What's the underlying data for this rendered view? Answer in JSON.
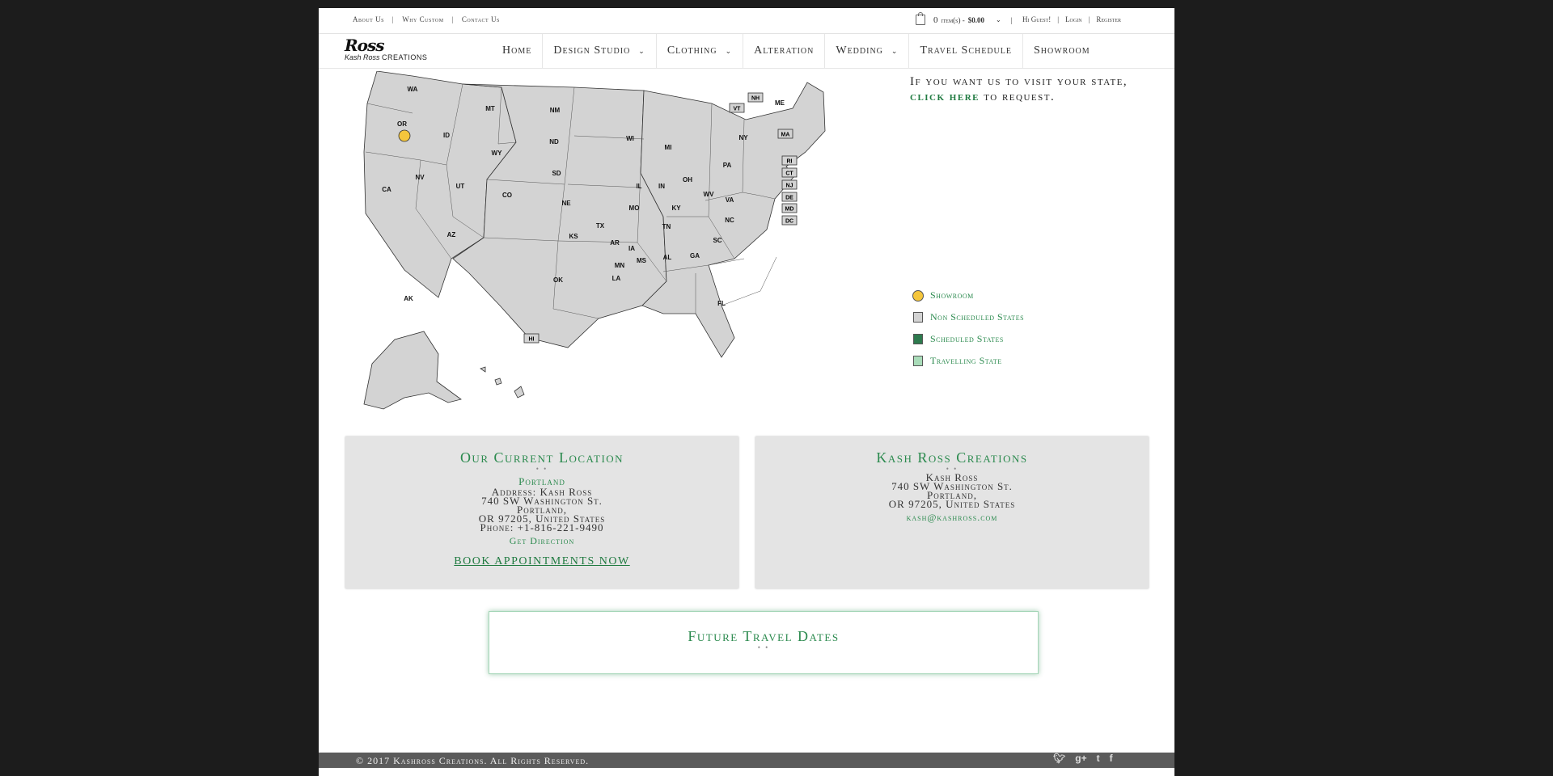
{
  "top_links": [
    "About Us",
    "Why Custom",
    "Contact Us"
  ],
  "cart": {
    "count": "0",
    "items_label": "item(s) -",
    "total": "$0.00"
  },
  "user_links": [
    "Hi Guest!",
    "Login",
    "Register"
  ],
  "logo": {
    "line1": "Ross",
    "line2a": "Kash Ross",
    "line2b": "CREATIONS"
  },
  "nav": [
    "Home",
    "Design Studio",
    "Clothing",
    "Alteration",
    "Wedding",
    "Travel Schedule",
    "Showroom"
  ],
  "visit": {
    "before": "If you want us to visit your state,",
    "link": "click here",
    "after": "to request."
  },
  "legend": [
    {
      "label": "Showroom",
      "color": "#f5c63c"
    },
    {
      "label": "Non Scheduled States",
      "color": "#d3d3d3"
    },
    {
      "label": "Scheduled States",
      "color": "#2e7a4e"
    },
    {
      "label": "Travelling State",
      "color": "#a9dcb9"
    }
  ],
  "map_states": [
    "WA",
    "OR",
    "CA",
    "ID",
    "NV",
    "MT",
    "WY",
    "UT",
    "AZ",
    "CO",
    "NM",
    "ND",
    "SD",
    "NE",
    "KS",
    "OK",
    "TX",
    "MN",
    "IA",
    "MO",
    "AR",
    "LA",
    "WI",
    "IL",
    "MI",
    "IN",
    "OH",
    "KY",
    "TN",
    "MS",
    "AL",
    "GA",
    "FL",
    "SC",
    "NC",
    "VA",
    "WV",
    "PA",
    "NY",
    "ME",
    "AK",
    "HI"
  ],
  "map_boxes": [
    "VT",
    "NH",
    "MA",
    "RI",
    "CT",
    "NJ",
    "DE",
    "MD",
    "DC"
  ],
  "current_location": {
    "title": "Our Current Location",
    "dots": "• •",
    "city": "Portland",
    "address_lines": [
      "Address: Kash Ross",
      "740 SW Washington St.",
      "Portland,",
      "OR 97205, United States",
      "Phone: +1-816-221-9490"
    ],
    "direction": "Get Direction",
    "book": "BOOK APPOINTMENTS NOW"
  },
  "creations": {
    "title": "Kash Ross Creations",
    "dots": "• •",
    "lines": [
      "Kash Ross",
      "740 SW Washington St.",
      "Portland,",
      "OR 97205, United States"
    ],
    "email": "kash@kashross.com"
  },
  "future": {
    "title": "Future Travel Dates",
    "dots": "• •"
  },
  "footer": {
    "copyright": "© 2017 Kashross Creations. All Rights Reserved.",
    "social": [
      "twitter-icon",
      "google-plus-icon",
      "tumblr-icon",
      "facebook-icon"
    ]
  },
  "colors": {
    "accent": "#2b8a4e",
    "map_fill": "#d3d3d3",
    "showroom": "#f5c63c"
  }
}
